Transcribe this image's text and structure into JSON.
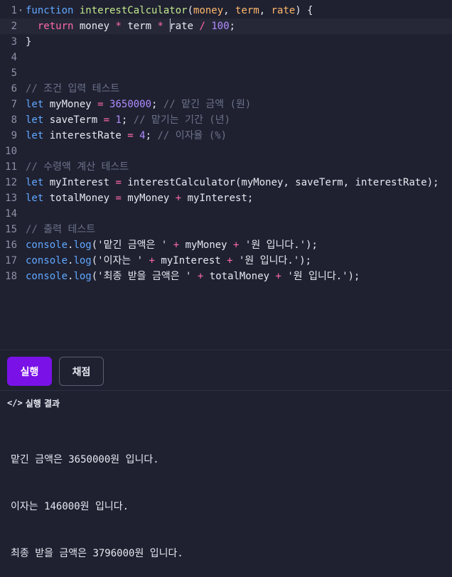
{
  "editor": {
    "lines": [
      {
        "num": "1",
        "fold": "▾",
        "segments": [
          [
            "kw",
            "function "
          ],
          [
            "fn",
            "interestCalculator"
          ],
          [
            "var",
            "("
          ],
          [
            "par",
            "money"
          ],
          [
            "var",
            ", "
          ],
          [
            "par",
            "term"
          ],
          [
            "var",
            ", "
          ],
          [
            "par",
            "rate"
          ],
          [
            "var",
            ") {"
          ]
        ]
      },
      {
        "num": "2",
        "fold": "",
        "active": true,
        "segments": [
          [
            "var",
            "  "
          ],
          [
            "ret",
            "return"
          ],
          [
            "var",
            " money "
          ],
          [
            "op",
            "*"
          ],
          [
            "var",
            " term "
          ],
          [
            "op",
            "*"
          ],
          [
            "var",
            " rate "
          ],
          [
            "op",
            "/"
          ],
          [
            "var",
            " "
          ],
          [
            "num",
            "100"
          ],
          [
            "var",
            ";"
          ]
        ]
      },
      {
        "num": "3",
        "fold": "",
        "segments": [
          [
            "var",
            "}"
          ]
        ]
      },
      {
        "num": "4",
        "fold": "",
        "segments": []
      },
      {
        "num": "5",
        "fold": "",
        "segments": []
      },
      {
        "num": "6",
        "fold": "",
        "segments": [
          [
            "cmt",
            "// 조건 입력 테스트"
          ]
        ]
      },
      {
        "num": "7",
        "fold": "",
        "segments": [
          [
            "kw",
            "let "
          ],
          [
            "var",
            "myMoney "
          ],
          [
            "op",
            "="
          ],
          [
            "var",
            " "
          ],
          [
            "num",
            "3650000"
          ],
          [
            "var",
            "; "
          ],
          [
            "cmt",
            "// 맡긴 금액 (원)"
          ]
        ]
      },
      {
        "num": "8",
        "fold": "",
        "segments": [
          [
            "kw",
            "let "
          ],
          [
            "var",
            "saveTerm "
          ],
          [
            "op",
            "="
          ],
          [
            "var",
            " "
          ],
          [
            "num",
            "1"
          ],
          [
            "var",
            "; "
          ],
          [
            "cmt",
            "// 맡기는 기간 (년)"
          ]
        ]
      },
      {
        "num": "9",
        "fold": "",
        "segments": [
          [
            "kw",
            "let "
          ],
          [
            "var",
            "interestRate "
          ],
          [
            "op",
            "="
          ],
          [
            "var",
            " "
          ],
          [
            "num",
            "4"
          ],
          [
            "var",
            "; "
          ],
          [
            "cmt",
            "// 이자율 (%)"
          ]
        ]
      },
      {
        "num": "10",
        "fold": "",
        "segments": []
      },
      {
        "num": "11",
        "fold": "",
        "segments": [
          [
            "cmt",
            "// 수령액 계산 테스트"
          ]
        ]
      },
      {
        "num": "12",
        "fold": "",
        "segments": [
          [
            "kw",
            "let "
          ],
          [
            "var",
            "myInterest "
          ],
          [
            "op",
            "="
          ],
          [
            "var",
            " interestCalculator(myMoney, saveTerm, interestRate);"
          ]
        ]
      },
      {
        "num": "13",
        "fold": "",
        "segments": [
          [
            "kw",
            "let "
          ],
          [
            "var",
            "totalMoney "
          ],
          [
            "op",
            "="
          ],
          [
            "var",
            " myMoney "
          ],
          [
            "op",
            "+"
          ],
          [
            "var",
            " myInterest;"
          ]
        ]
      },
      {
        "num": "14",
        "fold": "",
        "segments": []
      },
      {
        "num": "15",
        "fold": "",
        "segments": [
          [
            "cmt",
            "// 출력 테스트"
          ]
        ]
      },
      {
        "num": "16",
        "fold": "",
        "segments": [
          [
            "kw",
            "console"
          ],
          [
            "var",
            "."
          ],
          [
            "kw",
            "log"
          ],
          [
            "var",
            "('맡긴 금액은 ' "
          ],
          [
            "op",
            "+"
          ],
          [
            "var",
            " myMoney "
          ],
          [
            "op",
            "+"
          ],
          [
            "var",
            " '원 입니다.');"
          ]
        ]
      },
      {
        "num": "17",
        "fold": "",
        "segments": [
          [
            "kw",
            "console"
          ],
          [
            "var",
            "."
          ],
          [
            "kw",
            "log"
          ],
          [
            "var",
            "('이자는 ' "
          ],
          [
            "op",
            "+"
          ],
          [
            "var",
            " myInterest "
          ],
          [
            "op",
            "+"
          ],
          [
            "var",
            " '원 입니다.');"
          ]
        ]
      },
      {
        "num": "18",
        "fold": "",
        "segments": [
          [
            "kw",
            "console"
          ],
          [
            "var",
            "."
          ],
          [
            "kw",
            "log"
          ],
          [
            "var",
            "('최종 받을 금액은 ' "
          ],
          [
            "op",
            "+"
          ],
          [
            "var",
            " totalMoney "
          ],
          [
            "op",
            "+"
          ],
          [
            "var",
            " '원 입니다.');"
          ]
        ]
      }
    ]
  },
  "toolbar": {
    "run_label": "실행",
    "grade_label": "채점"
  },
  "result": {
    "icon": "</>",
    "title": "실행 결과",
    "output": [
      "맡긴 금액은 3650000원 입니다.",
      "이자는 146000원 입니다.",
      "최종 받을 금액은 3796000원 입니다."
    ]
  },
  "colors": {
    "background": "#1f2131",
    "accent": "#7a12e8",
    "keyword": "#61a8ff",
    "function": "#c3e88d",
    "param": "#ffb86c",
    "number": "#b18cff",
    "operator": "#ff6aa8",
    "comment": "#6c7289"
  }
}
